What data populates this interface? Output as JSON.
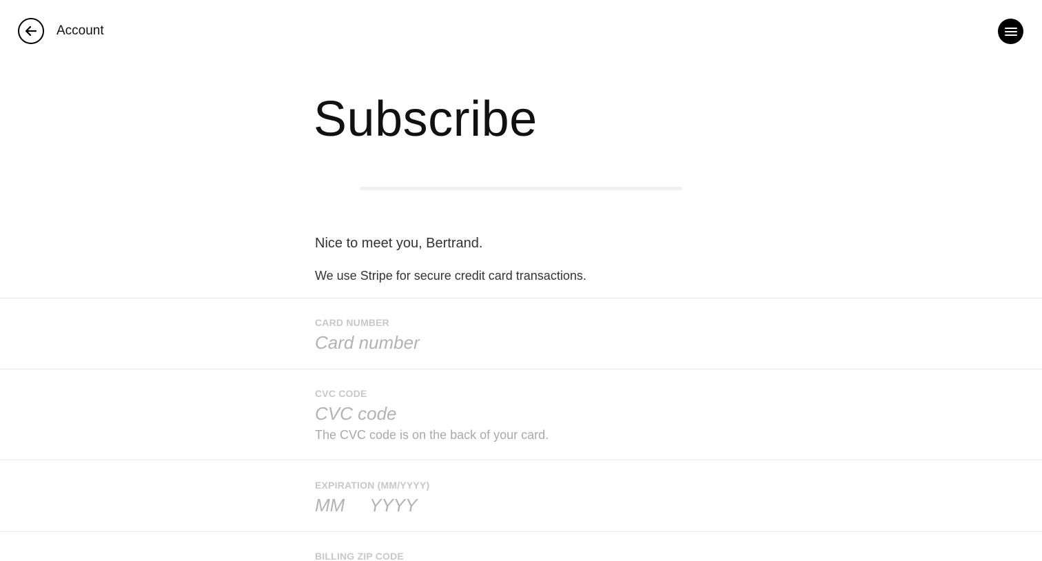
{
  "header": {
    "back_icon": "arrow-left-icon",
    "title": "Account",
    "menu_icon": "hamburger-menu-icon"
  },
  "main": {
    "title": "Subscribe",
    "progress": 1.0,
    "greeting": "Nice to meet you, Bertrand.",
    "stripe_note": "We use Stripe for secure credit card transactions."
  },
  "form": {
    "card_number": {
      "label": "CARD NUMBER",
      "placeholder": "Card number",
      "value": ""
    },
    "cvc": {
      "label": "CVC CODE",
      "placeholder": "CVC code",
      "value": "",
      "hint": "The CVC code is on the back of your card."
    },
    "expiration": {
      "label": "EXPIRATION (MM/YYYY)",
      "month_placeholder": "MM",
      "year_placeholder": "YYYY"
    },
    "zip": {
      "label": "BILLING ZIP CODE"
    }
  },
  "colors": {
    "text": "#111111",
    "label": "#c8c8c8",
    "placeholder": "#b3b3b3",
    "divider": "#e6e6e6",
    "button_bg": "#000000"
  }
}
